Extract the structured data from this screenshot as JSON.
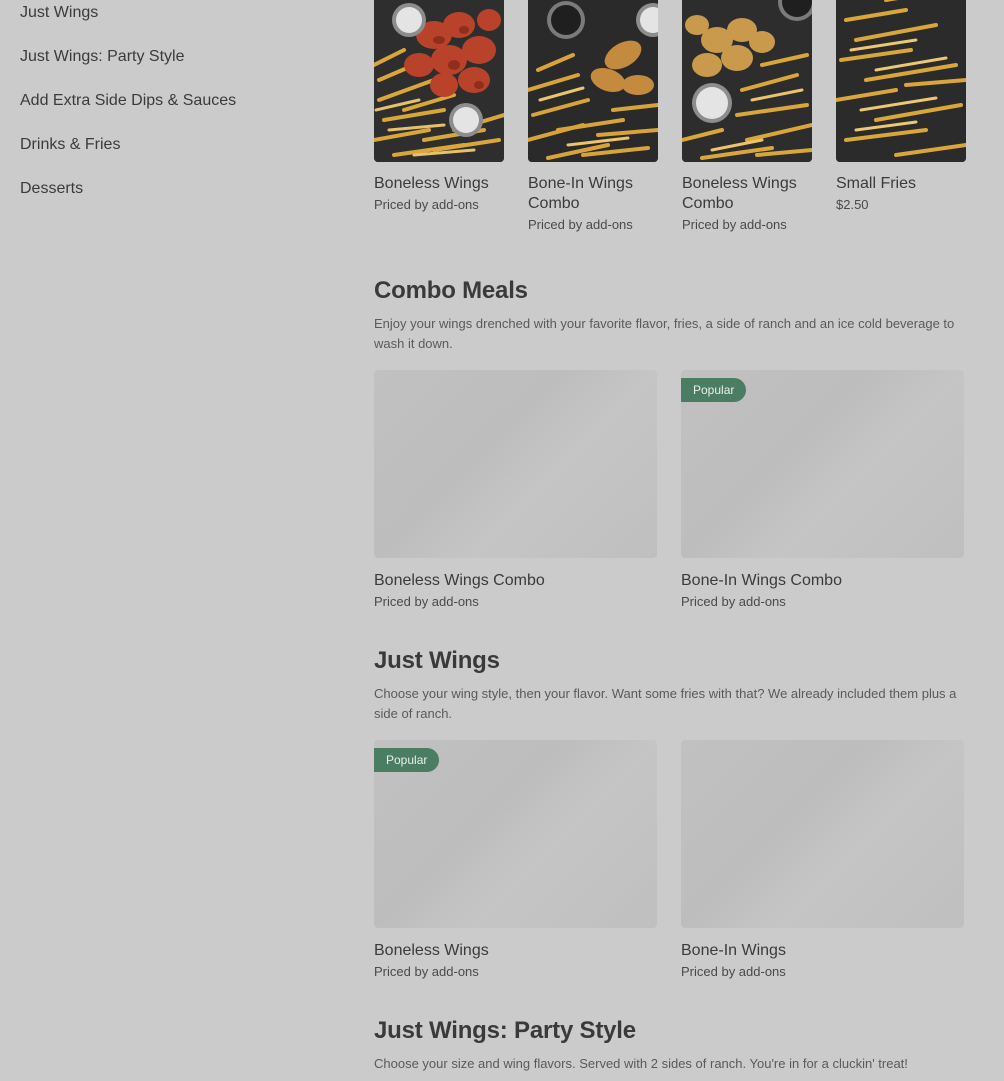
{
  "sidebar": {
    "items": [
      {
        "label": "Just Wings"
      },
      {
        "label": "Just Wings: Party Style"
      },
      {
        "label": "Add Extra Side Dips & Sauces"
      },
      {
        "label": "Drinks & Fries"
      },
      {
        "label": "Desserts"
      }
    ]
  },
  "top_row": [
    {
      "name": "Boneless Wings",
      "price": "Priced by add-ons"
    },
    {
      "name": "Bone-In Wings Combo",
      "price": "Priced by add-ons"
    },
    {
      "name": "Boneless Wings Combo",
      "price": "Priced by add-ons"
    },
    {
      "name": "Small Fries",
      "price": "$2.50"
    }
  ],
  "sections": [
    {
      "title": "Combo Meals",
      "description": "Enjoy your wings drenched with your favorite flavor, fries, a side of ranch and an ice cold beverage to wash it down.",
      "items": [
        {
          "name": "Boneless Wings Combo",
          "price": "Priced by add-ons",
          "badge": ""
        },
        {
          "name": "Bone-In Wings Combo",
          "price": "Priced by add-ons",
          "badge": "Popular"
        }
      ]
    },
    {
      "title": "Just Wings",
      "description": "Choose your wing style, then your flavor. Want some fries with that? We already included them plus a side of ranch.",
      "items": [
        {
          "name": "Boneless Wings",
          "price": "Priced by add-ons",
          "badge": "Popular"
        },
        {
          "name": "Bone-In Wings",
          "price": "Priced by add-ons",
          "badge": ""
        }
      ]
    },
    {
      "title": "Just Wings: Party Style",
      "description": "Choose your size and wing flavors. Served with 2 sides of ranch. You're in for a cluckin' treat!"
    }
  ],
  "colors": {
    "background": "#cbcbcb",
    "badge": "#4a7d62",
    "text": "#3a3a3a"
  }
}
